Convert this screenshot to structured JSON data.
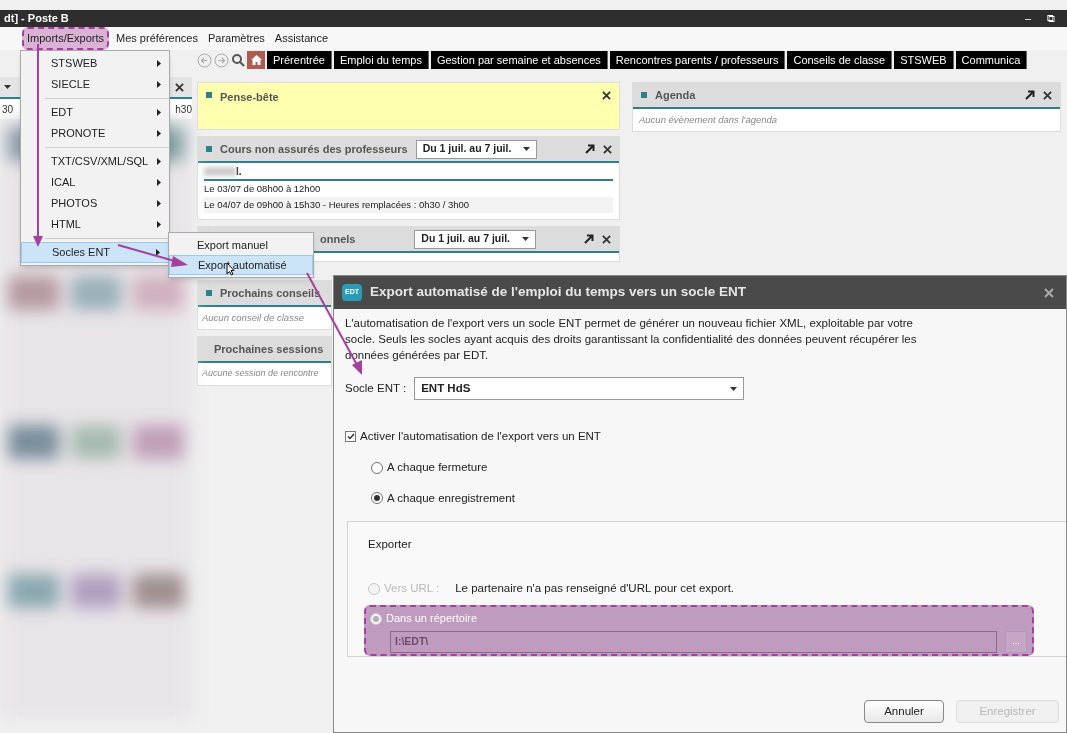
{
  "window": {
    "title": "dt] - Poste B",
    "controls": [
      "–",
      "⧉"
    ]
  },
  "menu_bar": [
    {
      "label": "Imports/Exports",
      "highlighted": true
    },
    {
      "label": "Mes préférences",
      "highlighted": false
    },
    {
      "label": "Paramètres",
      "highlighted": false
    },
    {
      "label": "Assistance",
      "highlighted": false
    }
  ],
  "imports_menu": [
    {
      "kind": "item",
      "label": "STSWEB",
      "selected": false
    },
    {
      "kind": "item",
      "label": "SIECLE",
      "selected": false
    },
    {
      "kind": "separator"
    },
    {
      "kind": "item",
      "label": "EDT",
      "selected": false
    },
    {
      "kind": "item",
      "label": "PRONOTE",
      "selected": false
    },
    {
      "kind": "separator"
    },
    {
      "kind": "item",
      "label": "TXT/CSV/XML/SQL",
      "selected": false
    },
    {
      "kind": "item",
      "label": "ICAL",
      "selected": false
    },
    {
      "kind": "item",
      "label": "PHOTOS",
      "selected": false
    },
    {
      "kind": "item",
      "label": "HTML",
      "selected": false
    },
    {
      "kind": "separator"
    },
    {
      "kind": "item",
      "label": "Socles ENT",
      "selected": true
    }
  ],
  "submenu": [
    {
      "label": "Export manuel",
      "selected": false
    },
    {
      "label": "Export automatisé",
      "selected": true
    }
  ],
  "toolbar": {
    "tabs": [
      {
        "kind": "home",
        "selected": true
      },
      {
        "kind": "text",
        "label": "Prérentrée",
        "selected": false
      },
      {
        "kind": "text",
        "label": "Emploi du temps",
        "selected": false
      },
      {
        "kind": "text",
        "label": "Gestion par semaine et absences",
        "selected": false
      },
      {
        "kind": "text",
        "label": "Rencontres parents / professeurs",
        "selected": false
      },
      {
        "kind": "text",
        "label": "Conseils de classe",
        "selected": false
      },
      {
        "kind": "text",
        "label": "STSWEB",
        "selected": false
      },
      {
        "kind": "text",
        "label": "Communica",
        "selected": false
      }
    ]
  },
  "left_panel": {
    "row_start": "30",
    "row_end": "h30"
  },
  "pense_bete": {
    "title": "Pense-bête"
  },
  "cours_non_assures": {
    "title": "Cours non assurés des professeurs",
    "period": "Du 1 juil. au 7 juil.",
    "teacher": "I.",
    "lines": [
      "Le 03/07 de 08h00 à 12h00",
      "Le 04/07 de 09h00 à 15h30 - Heures remplacées : 0h30 / 3h00"
    ]
  },
  "panel_3": {
    "title": "onnels",
    "period": "Du 1 juil. au 7 juil."
  },
  "conseils": {
    "title": "Prochains conseils",
    "empty": "Aucun conseil de classe"
  },
  "sessions": {
    "title": "Prochaines sessions",
    "empty": "Aucune session de rencontre"
  },
  "agenda": {
    "title": "Agenda",
    "empty": "Aucun évènement dans l'agenda"
  },
  "dialog": {
    "icon_text": "EDT",
    "title": "Export automatisé de l'emploi du temps vers un socle ENT",
    "description": "L'automatisation de l'export vers un socle ENT permet de générer un nouveau fichier XML, exploitable par votre socle. Seuls les socles ayant acquis des droits garantissant la confidentialité des données peuvent récupérer les données générées par EDT.",
    "socle_label": "Socle ENT :",
    "socle_value": "ENT HdS",
    "activate": {
      "label": "Activer l'automatisation de l'export vers un ENT",
      "checked": true
    },
    "options": [
      {
        "label": "A chaque fermeture",
        "selected": false
      },
      {
        "label": "A chaque enregistrement",
        "selected": true
      }
    ],
    "export": {
      "title": "Exporter",
      "url_option": {
        "label": "Vers URL :",
        "selected": false,
        "disabled": true
      },
      "url_note": "Le partenaire n'a pas renseigné d'URL pour cet export.",
      "dir_option": {
        "label": "Dans un répertoire",
        "selected": true,
        "disabled": true,
        "highlighted": true
      },
      "path": "I:\\EDT\\",
      "browse": "..."
    },
    "buttons": [
      {
        "label": "Annuler",
        "disabled": false
      },
      {
        "label": "Enregistrer",
        "disabled": true
      }
    ]
  }
}
